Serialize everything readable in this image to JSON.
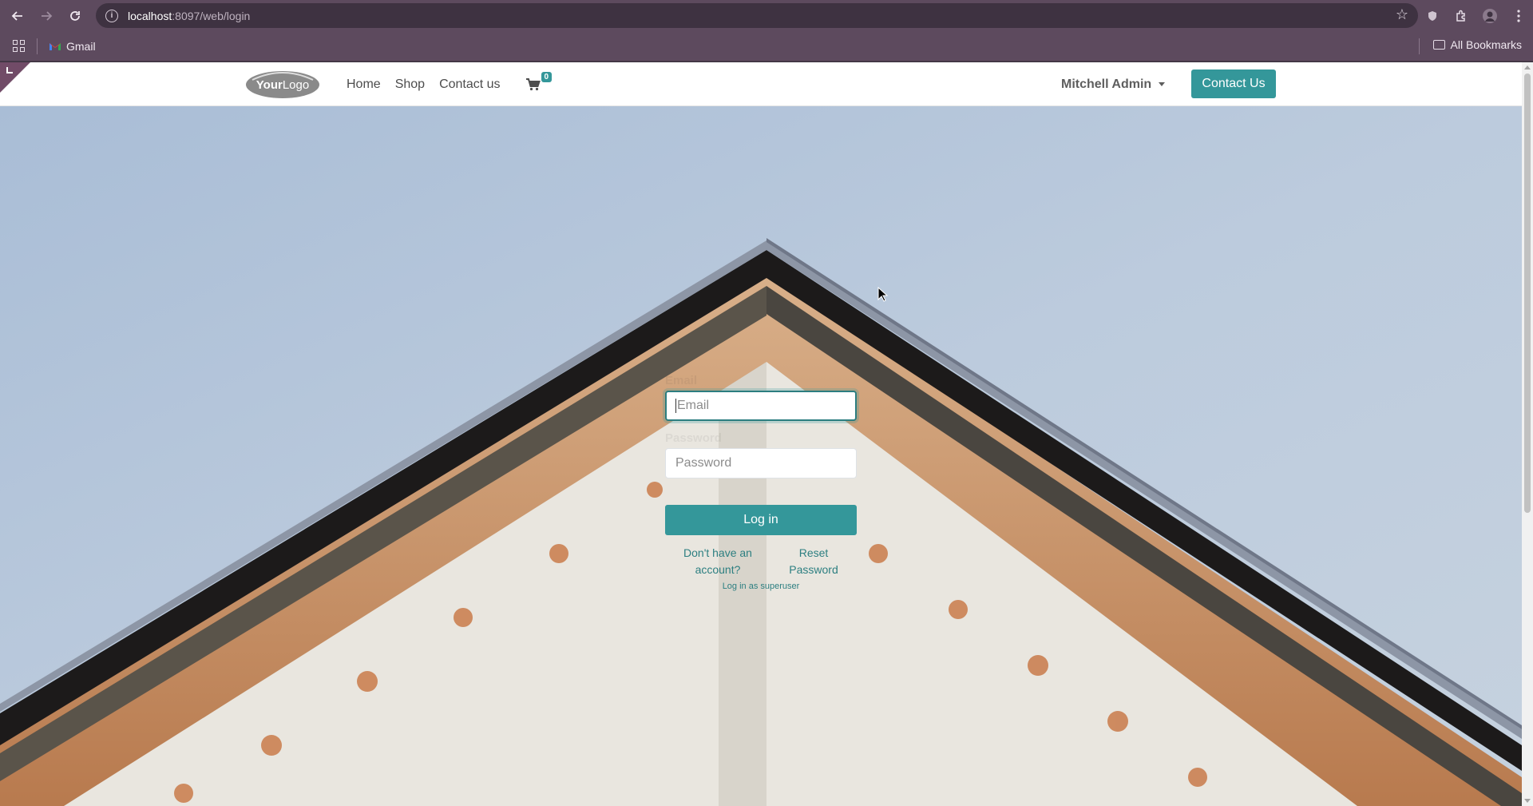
{
  "browser": {
    "url_host": "localhost",
    "url_path": ":8097/web/login",
    "bookmarks": [
      {
        "label": "Gmail"
      }
    ],
    "all_bookmarks_label": "All Bookmarks"
  },
  "site": {
    "logo_text": "YourLogo",
    "nav": [
      {
        "label": "Home"
      },
      {
        "label": "Shop"
      },
      {
        "label": "Contact us"
      }
    ],
    "cart_count": "0",
    "user_name": "Mitchell Admin",
    "contact_button": "Contact Us"
  },
  "login": {
    "email_label": "Email",
    "email_placeholder": "Email",
    "password_label": "Password",
    "password_placeholder": "Password",
    "login_button": "Log in",
    "signup_link": "Don't have an account?",
    "reset_link": "Reset Password",
    "superuser_link": "Log in as superuser"
  },
  "colors": {
    "accent": "#34979a",
    "browser_frame": "#5d4a5e",
    "edit_corner": "#714b67",
    "sky": "#b4c6dc"
  }
}
